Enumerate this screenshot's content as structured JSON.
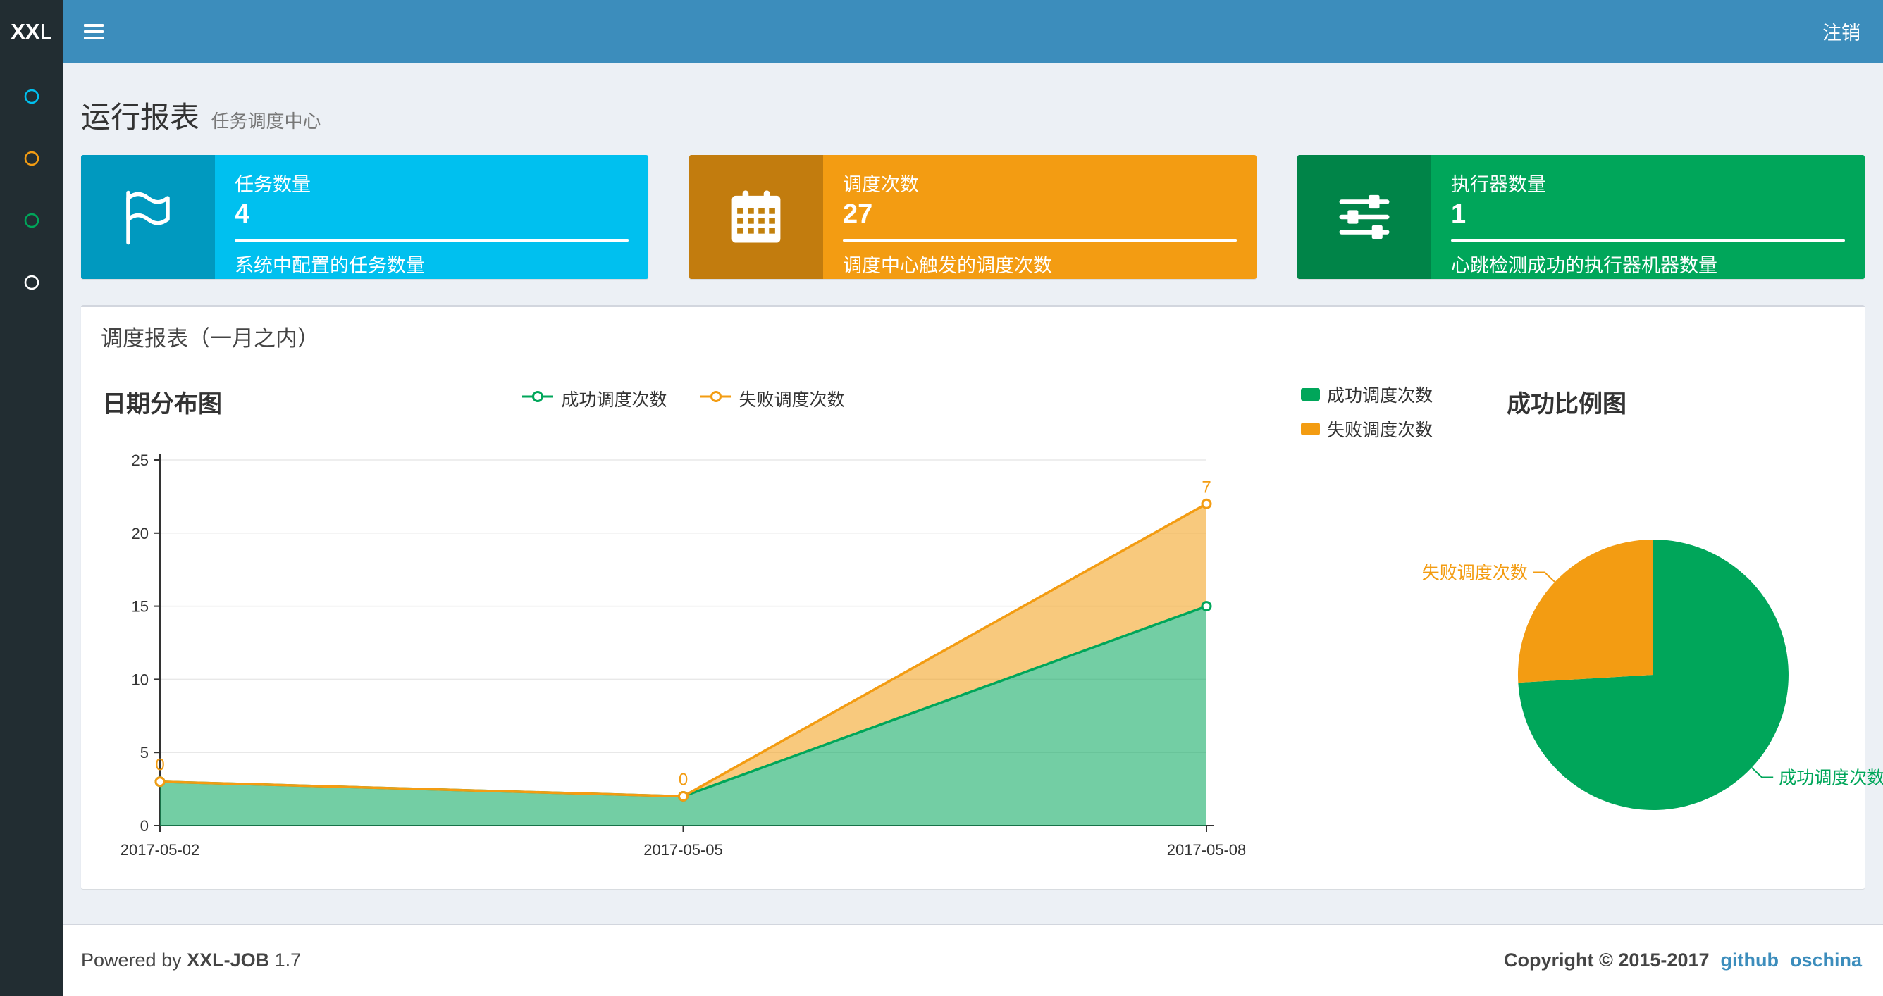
{
  "colors": {
    "navbar": "#3c8dbc",
    "sidebar": "#222d32",
    "content_bg": "#ecf0f5",
    "link": "#3c8dbc"
  },
  "navbar": {
    "logo_bold": "XX",
    "logo_rest": "L",
    "logout_label": "注销"
  },
  "sidebar": {
    "items": [
      {
        "icon": "circle-icon",
        "color": "#00c0ef"
      },
      {
        "icon": "circle-icon",
        "color": "#f39c12"
      },
      {
        "icon": "circle-icon",
        "color": "#00a65a"
      },
      {
        "icon": "circle-icon",
        "color": "#ffffff"
      }
    ]
  },
  "page_header": {
    "title": "运行报表",
    "subtitle": "任务调度中心"
  },
  "info_boxes": [
    {
      "title": "任务数量",
      "number": "4",
      "description": "系统中配置的任务数量",
      "color": "#00c0ef",
      "icon": "flag-icon"
    },
    {
      "title": "调度次数",
      "number": "27",
      "description": "调度中心触发的调度次数",
      "color": "#f39c12",
      "icon": "calendar-icon"
    },
    {
      "title": "执行器数量",
      "number": "1",
      "description": "心跳检测成功的执行器机器数量",
      "color": "#00a65a",
      "icon": "sliders-icon"
    }
  ],
  "panel": {
    "title": "调度报表（一月之内）"
  },
  "chart_data": [
    {
      "type": "area",
      "title": "日期分布图",
      "x": [
        "2017-05-02",
        "2017-05-05",
        "2017-05-08"
      ],
      "series": [
        {
          "name": "成功调度次数",
          "color": "#00a65a",
          "values": [
            3,
            2,
            15
          ]
        },
        {
          "name": "失败调度次数",
          "color": "#f39c12",
          "values": [
            0,
            0,
            7
          ],
          "point_labels": [
            "0",
            "0",
            "7"
          ]
        }
      ],
      "stacked": true,
      "ylim": [
        0,
        25
      ],
      "yticks": [
        0,
        5,
        10,
        15,
        20,
        25
      ],
      "grid": true,
      "legend_position": "top-center"
    },
    {
      "type": "pie",
      "title": "成功比例图",
      "slices": [
        {
          "name": "成功调度次数",
          "value": 20,
          "color": "#00a65a"
        },
        {
          "name": "失败调度次数",
          "value": 7,
          "color": "#f39c12"
        }
      ],
      "legend_position": "top-left"
    }
  ],
  "footer": {
    "powered_prefix": "Powered by",
    "product": "XXL-JOB",
    "version": "1.7",
    "copyright": "Copyright © 2015-2017",
    "links": [
      "github",
      "oschina"
    ]
  }
}
